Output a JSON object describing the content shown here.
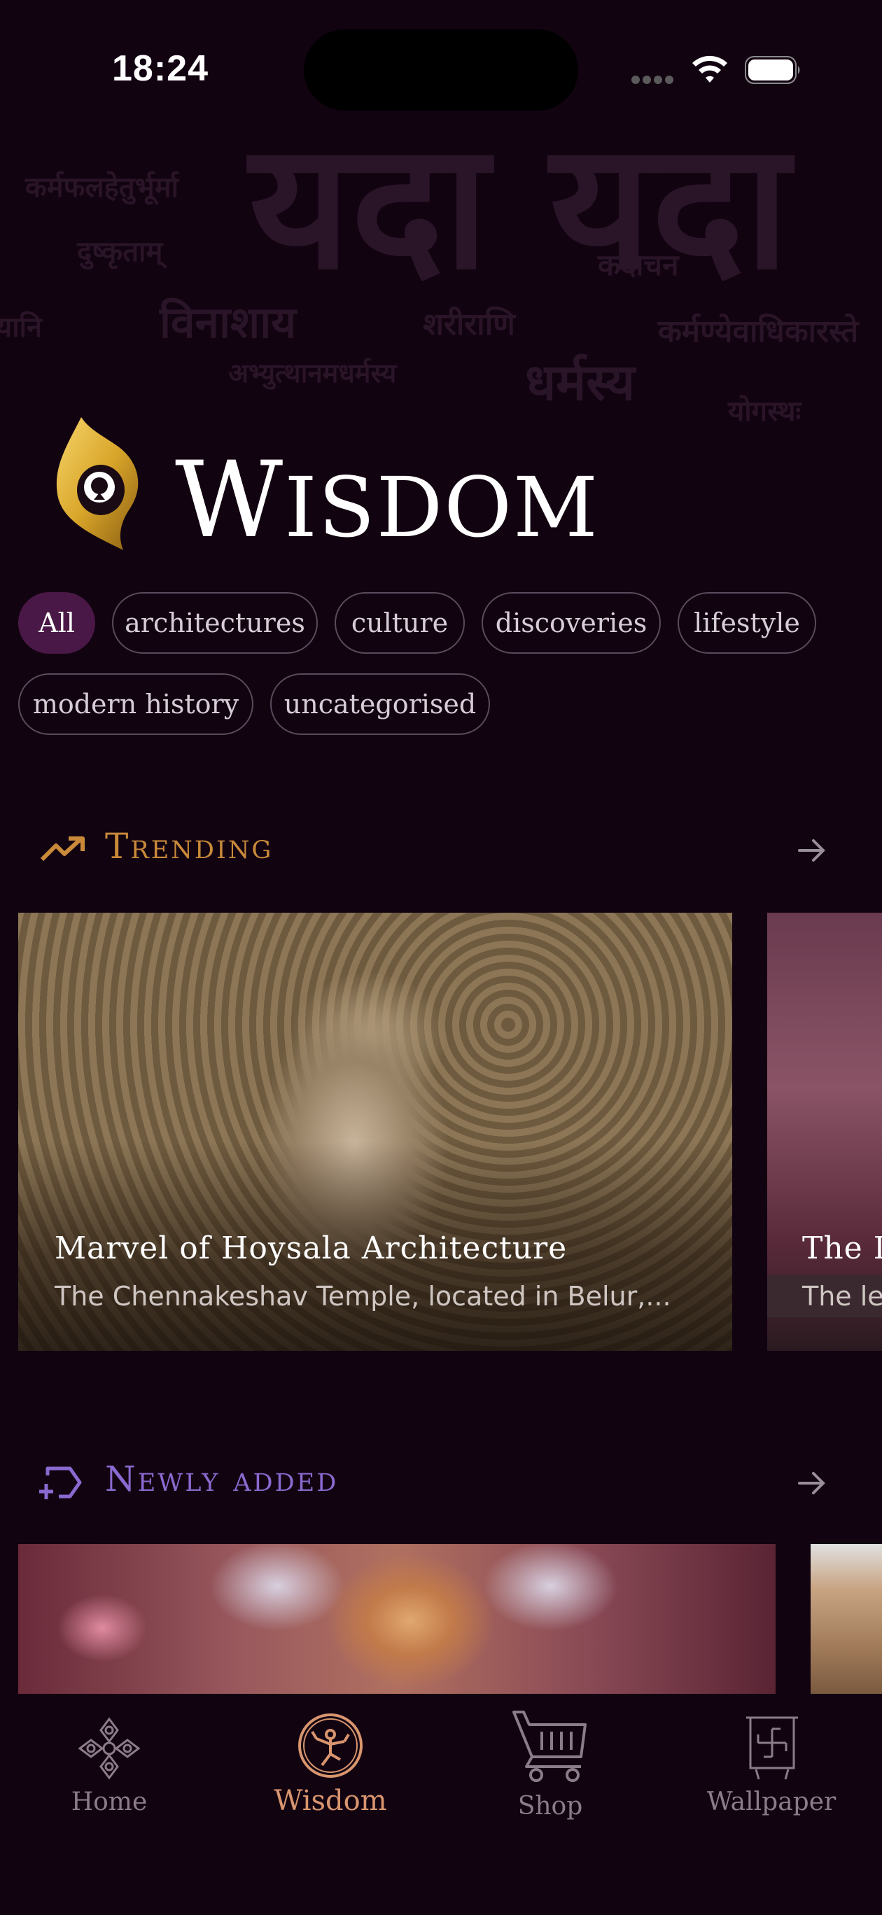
{
  "status_bar": {
    "time": "18:24"
  },
  "background_words": [
    "यदा यदा",
    "कर्मफलहेतुर्भूर्मा",
    "दुष्कृताम्",
    "कदाचन",
    "यानि",
    "विनाशाय",
    "शरीराणि",
    "कर्मण्येवाधिकारस्ते",
    "अभ्युत्थानमधर्मस्य",
    "धर्मस्य",
    "योगस्थः"
  ],
  "header": {
    "logo": "peacock-feather-logo",
    "title": "Wisdom"
  },
  "filters": [
    {
      "label": "All",
      "active": true
    },
    {
      "label": "architectures",
      "active": false
    },
    {
      "label": "culture",
      "active": false
    },
    {
      "label": "discoveries",
      "active": false
    },
    {
      "label": "lifestyle",
      "active": false
    },
    {
      "label": "modern history",
      "active": false
    },
    {
      "label": "uncategorised",
      "active": false
    }
  ],
  "trending": {
    "title": "Trending",
    "icon": "trending-up-icon",
    "color": "#c98a3a",
    "cards": [
      {
        "title": "Marvel of Hoysala Architecture",
        "subtitle": "The Chennakeshav Temple, located in Belur,..."
      },
      {
        "title": "The I",
        "subtitle": "The le"
      }
    ]
  },
  "newly_added": {
    "title": "Newly added",
    "icon": "queue-add-icon",
    "color": "#8a6ad0"
  },
  "tabs": [
    {
      "label": "Home",
      "icon": "mandala-flower-icon",
      "active": false
    },
    {
      "label": "Wisdom",
      "icon": "nataraja-icon",
      "active": true
    },
    {
      "label": "Shop",
      "icon": "shopping-cart-icon",
      "active": false
    },
    {
      "label": "Wallpaper",
      "icon": "swastika-frame-icon",
      "active": false
    }
  ]
}
